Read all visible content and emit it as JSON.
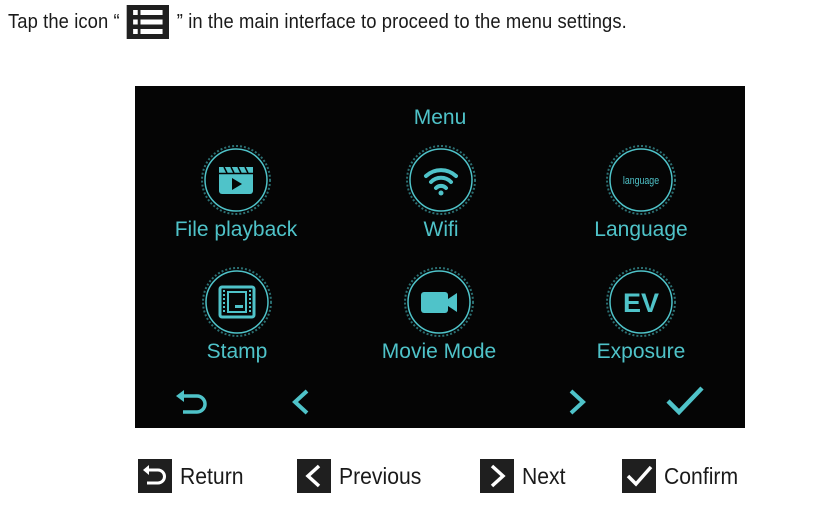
{
  "instruction": {
    "before": "Tap the icon “",
    "after": "” in the main interface to proceed to the menu settings.",
    "icon": "list-menu-icon"
  },
  "screen": {
    "title": "Menu",
    "accent_color": "#4fc3c9",
    "background_color": "#050505",
    "items": [
      {
        "label": "File playback",
        "icon": "film-play-icon"
      },
      {
        "label": "Wifi",
        "icon": "wifi-icon"
      },
      {
        "label": "Language",
        "icon": "language-icon",
        "icon_text": "language"
      },
      {
        "label": "Stamp",
        "icon": "stamp-frame-icon"
      },
      {
        "label": "Movie Mode",
        "icon": "video-camera-icon"
      },
      {
        "label": "Exposure",
        "icon": "exposure-ev-icon",
        "icon_text": "EV"
      }
    ],
    "nav": [
      {
        "icon": "return-arrow-icon"
      },
      {
        "icon": "chevron-left-icon"
      },
      {
        "icon": "chevron-right-icon"
      },
      {
        "icon": "checkmark-icon"
      }
    ]
  },
  "legend": [
    {
      "label": "Return",
      "icon": "return-arrow-icon"
    },
    {
      "label": "Previous",
      "icon": "chevron-left-icon"
    },
    {
      "label": "Next",
      "icon": "chevron-right-icon"
    },
    {
      "label": "Confirm",
      "icon": "checkmark-icon"
    }
  ]
}
